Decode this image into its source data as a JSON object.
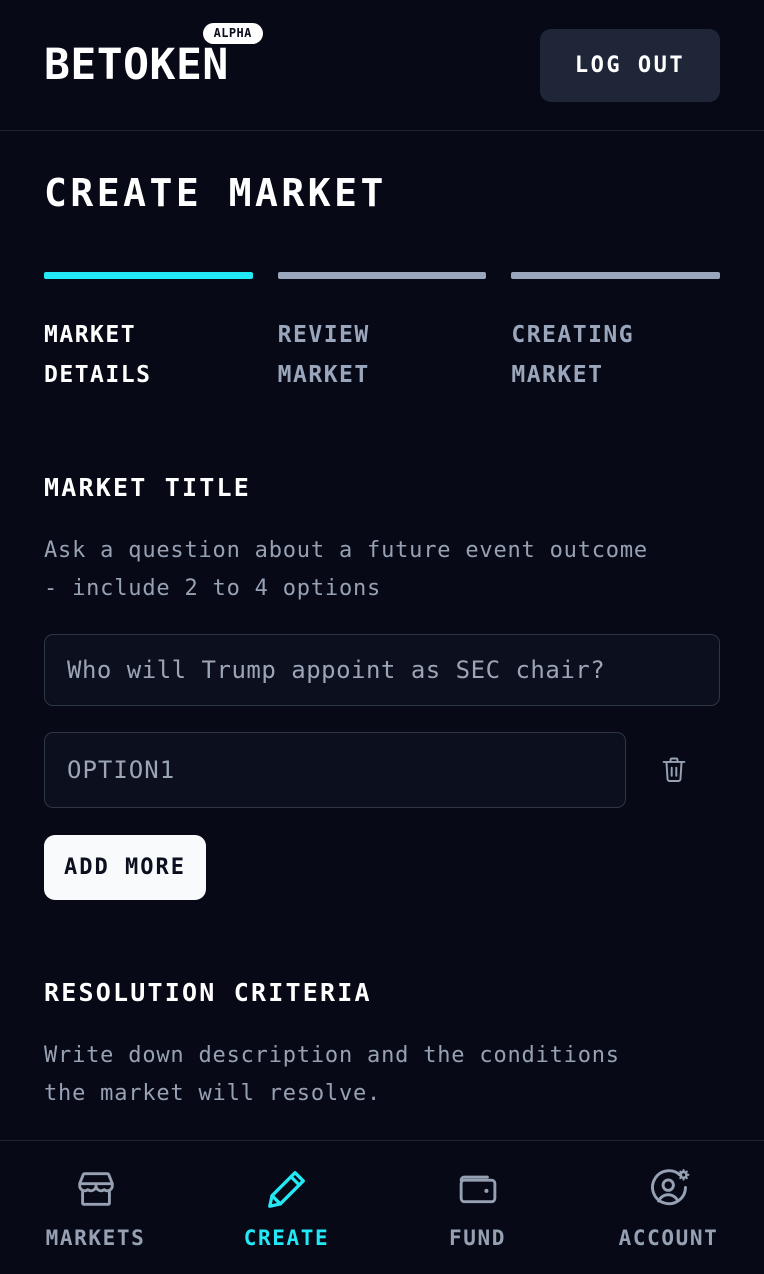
{
  "header": {
    "brand": "BETOKEN",
    "badge": "ALPHA",
    "logout_label": "LOG OUT"
  },
  "page": {
    "title": "CREATE MARKET"
  },
  "stepper": {
    "steps": [
      {
        "label": "MARKET\nDETAILS",
        "active": true
      },
      {
        "label": "REVIEW\nMARKET",
        "active": false
      },
      {
        "label": "CREATING\nMARKET",
        "active": false
      }
    ]
  },
  "market_title_section": {
    "heading": "MARKET TITLE",
    "help": "Ask a question about a future event outcome\n- include 2 to 4 options",
    "title_input": {
      "value": "",
      "placeholder": "Who will Trump appoint as SEC chair?"
    },
    "option_input": {
      "value": "",
      "placeholder": "OPTION1"
    },
    "add_more_label": "ADD MORE"
  },
  "resolution_section": {
    "heading": "RESOLUTION CRITERIA",
    "help": "Write down description and the conditions\nthe market will resolve."
  },
  "bottom_nav": {
    "items": [
      {
        "label": "MARKETS",
        "icon": "storefront-icon",
        "active": false
      },
      {
        "label": "CREATE",
        "icon": "pencil-icon",
        "active": true
      },
      {
        "label": "FUND",
        "icon": "wallet-icon",
        "active": false
      },
      {
        "label": "ACCOUNT",
        "icon": "user-gear-icon",
        "active": false
      }
    ]
  },
  "colors": {
    "background": "#070A16",
    "accent": "#22E9F5",
    "muted": "#97A1B4",
    "panel": "#1E2638",
    "border": "#2E3545"
  }
}
